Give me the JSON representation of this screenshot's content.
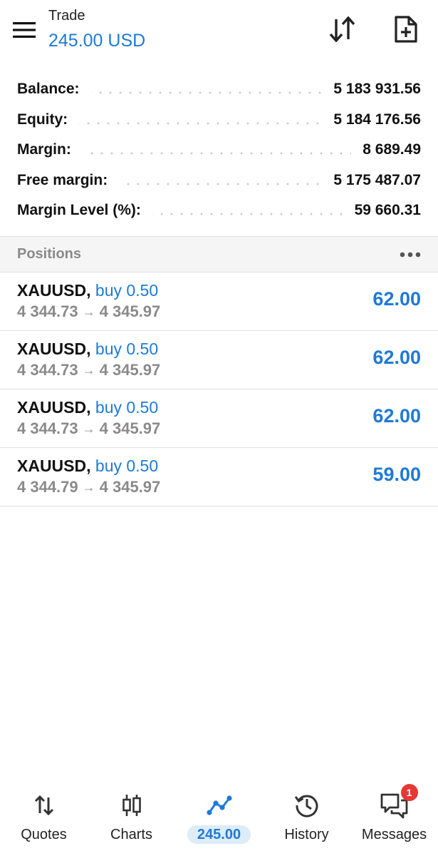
{
  "header": {
    "title": "Trade",
    "subtitle": "245.00 USD",
    "icons": {
      "menu": "hamburger-icon",
      "sort": "sort-arrows-icon",
      "new_order": "new-order-icon"
    }
  },
  "summary": [
    {
      "label": "Balance:",
      "value": "5 183 931.56"
    },
    {
      "label": "Equity:",
      "value": "5 184 176.56"
    },
    {
      "label": "Margin:",
      "value": "8 689.49"
    },
    {
      "label": "Free margin:",
      "value": "5 175 487.07"
    },
    {
      "label": "Margin Level (%):",
      "value": "59 660.31"
    }
  ],
  "positions": {
    "title": "Positions",
    "more_icon": "more-dots-icon",
    "items": [
      {
        "symbol": "XAUUSD",
        "separator": ",",
        "type": "buy 0.50",
        "open_price": "4 344.73",
        "arrow": "→",
        "current_price": "4 345.97",
        "profit": "62.00"
      },
      {
        "symbol": "XAUUSD",
        "separator": ",",
        "type": "buy 0.50",
        "open_price": "4 344.73",
        "arrow": "→",
        "current_price": "4 345.97",
        "profit": "62.00"
      },
      {
        "symbol": "XAUUSD",
        "separator": ",",
        "type": "buy 0.50",
        "open_price": "4 344.73",
        "arrow": "→",
        "current_price": "4 345.97",
        "profit": "62.00"
      },
      {
        "symbol": "XAUUSD",
        "separator": ",",
        "type": "buy 0.50",
        "open_price": "4 344.79",
        "arrow": "→",
        "current_price": "4 345.97",
        "profit": "59.00"
      }
    ]
  },
  "nav": {
    "items": [
      {
        "label": "Quotes",
        "icon": "quotes-arrows-icon"
      },
      {
        "label": "Charts",
        "icon": "candlestick-icon"
      },
      {
        "label": "245.00",
        "icon": "trade-line-icon",
        "active": true
      },
      {
        "label": "History",
        "icon": "history-clock-icon"
      },
      {
        "label": "Messages",
        "icon": "messages-icon",
        "badge": "1"
      }
    ]
  },
  "colors": {
    "accent": "#1e7ad6",
    "muted": "#8a8a8a",
    "badge": "#e53935",
    "active_pill": "#dcecf9"
  }
}
